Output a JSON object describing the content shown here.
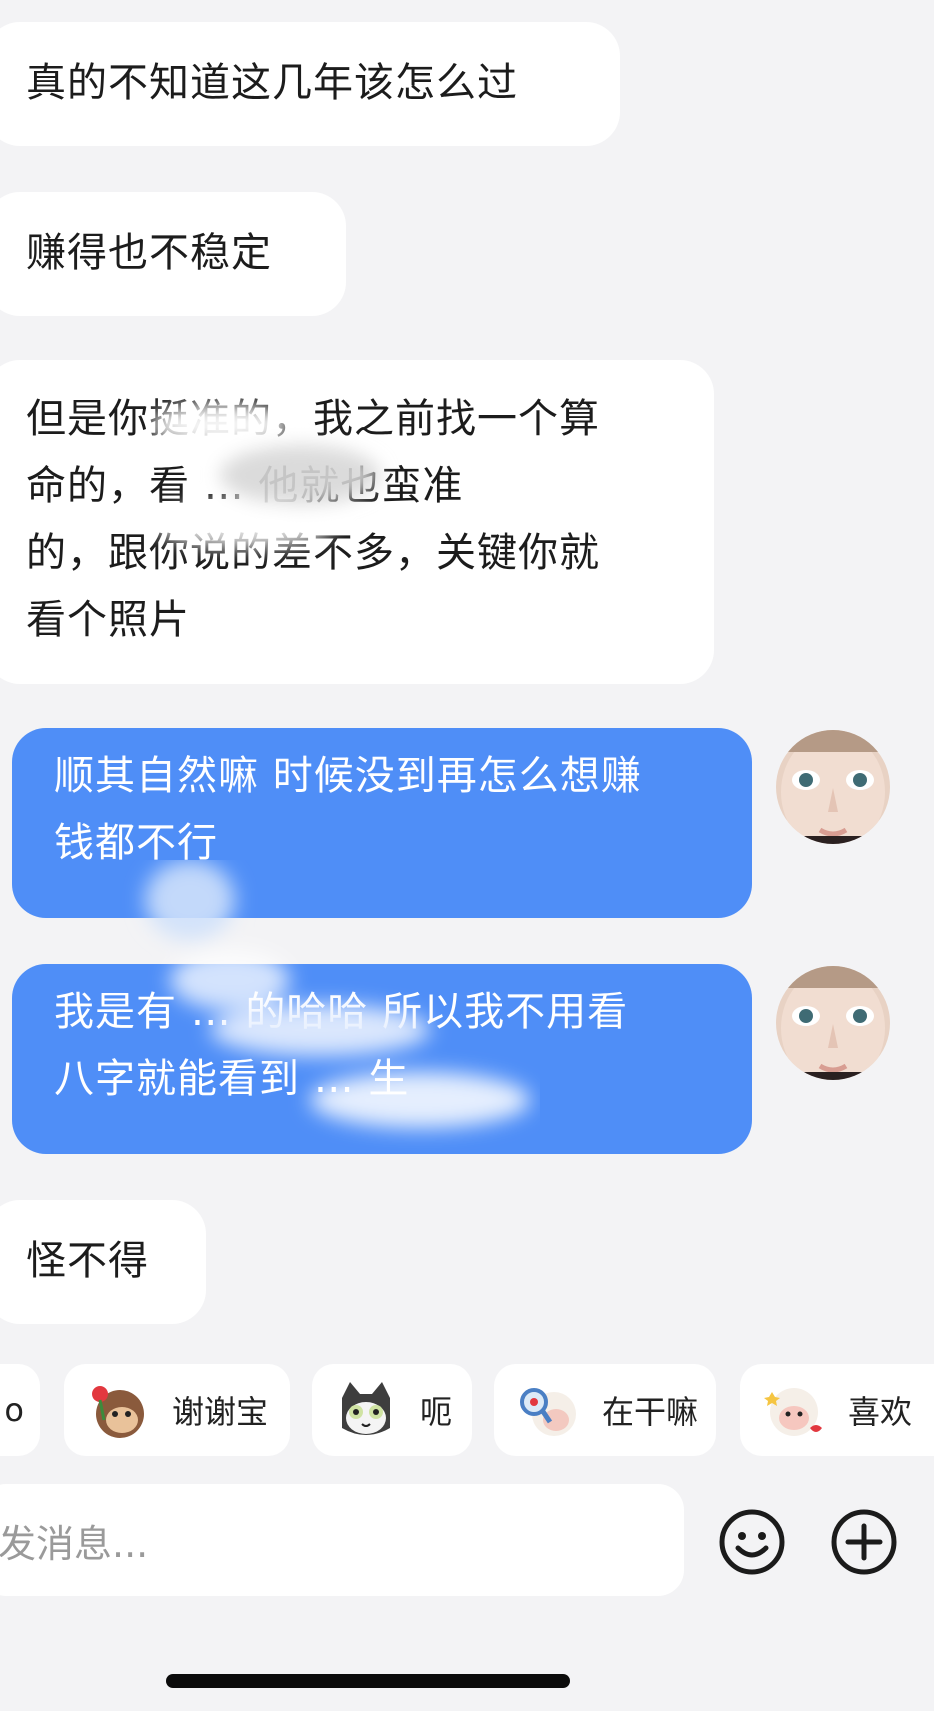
{
  "messages": [
    {
      "from": "other",
      "text": "真的不知道这几年该怎么过"
    },
    {
      "from": "other",
      "text": "赚得也不稳定"
    },
    {
      "from": "other",
      "lines": [
        "但是你挺准的，我之前找一个算",
        "命的，看 … 他就也蛮准",
        "的，跟你说的差不多，关键你就",
        "看个照片"
      ]
    },
    {
      "from": "me",
      "lines": [
        "顺其自然嘛 时候没到再怎么想赚",
        "钱都不行"
      ]
    },
    {
      "from": "me",
      "lines": [
        "我是有 … 的哈哈 所以我不用看",
        "八字就能看到 … 生"
      ]
    },
    {
      "from": "other",
      "text": "怪不得"
    }
  ],
  "quick_replies": [
    {
      "label": "o",
      "icon": "partial-sticker"
    },
    {
      "label": "谢谢宝",
      "icon": "monkey-flower-sticker"
    },
    {
      "label": "呃",
      "icon": "cat-sticker"
    },
    {
      "label": "在干嘛",
      "icon": "sheep-magnifier-sticker"
    },
    {
      "label": "喜欢",
      "icon": "sheep-love-sticker"
    }
  ],
  "composer": {
    "placeholder": "发消息..."
  },
  "colors": {
    "background": "#f3f3f5",
    "incoming_bubble": "#ffffff",
    "outgoing_bubble": "#4f8ef7"
  }
}
